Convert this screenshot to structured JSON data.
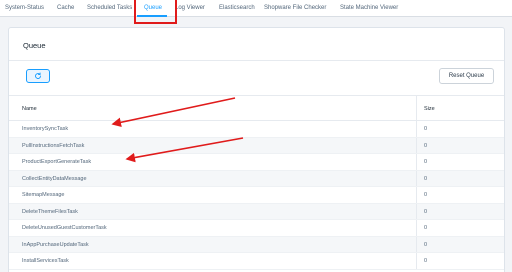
{
  "tabs": [
    {
      "label": "System-Status"
    },
    {
      "label": "Cache"
    },
    {
      "label": "Scheduled Tasks"
    },
    {
      "label": "Queue"
    },
    {
      "label": "Log Viewer"
    },
    {
      "label": "Elasticsearch"
    },
    {
      "label": "Shopware File Checker"
    },
    {
      "label": "State Machine Viewer"
    }
  ],
  "active_tab": "Queue",
  "card": {
    "title": "Queue",
    "refresh_icon": "refresh-icon",
    "reset_label": "Reset Queue"
  },
  "table": {
    "headers": {
      "name": "Name",
      "size": "Size"
    },
    "rows": [
      {
        "name": "InventorySyncTask",
        "size": "0"
      },
      {
        "name": "PullInstructionsFetchTask",
        "size": "0"
      },
      {
        "name": "ProductExportGenerateTask",
        "size": "0"
      },
      {
        "name": "CollectEntityDataMessage",
        "size": "0"
      },
      {
        "name": "SitemapMessage",
        "size": "0"
      },
      {
        "name": "DeleteThemeFilesTask",
        "size": "0"
      },
      {
        "name": "DeleteUnusedGuestCustomerTask",
        "size": "0"
      },
      {
        "name": "InAppPurchaseUpdateTask",
        "size": "0"
      },
      {
        "name": "InstallServicesTask",
        "size": "0"
      }
    ]
  },
  "colors": {
    "accent": "#189eff",
    "annotation": "#e01b1b"
  }
}
